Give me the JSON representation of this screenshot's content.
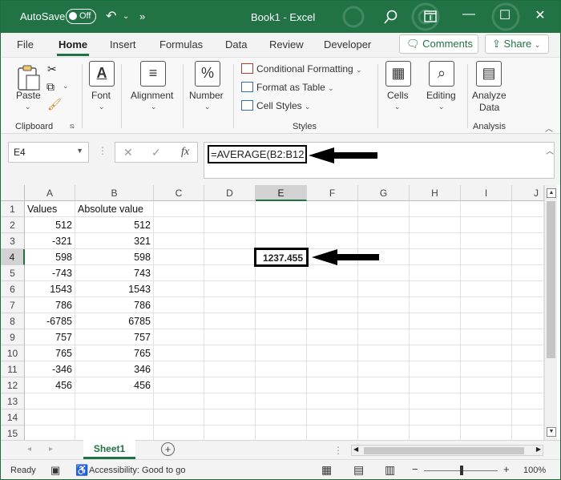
{
  "titlebar": {
    "autosave_label": "AutoSave",
    "toggle_state": "Off",
    "document_title": "Book1 - Excel",
    "undo_icon": "undo-icon",
    "more_icon": "chevron-double-right-icon",
    "search_icon": "search-icon",
    "brand_color": "#217346"
  },
  "menu": {
    "tabs": [
      "File",
      "Home",
      "Insert",
      "Formulas",
      "Data",
      "Review",
      "Developer"
    ],
    "active_tab": "Home",
    "comments_label": "Comments",
    "share_label": "Share"
  },
  "ribbon": {
    "paste_label": "Paste",
    "font_label": "Font",
    "alignment_label": "Alignment",
    "number_label": "Number",
    "conditional_formatting_label": "Conditional Formatting",
    "format_as_table_label": "Format as Table",
    "cell_styles_label": "Cell Styles",
    "cells_label": "Cells",
    "editing_label": "Editing",
    "analyze_data_label_1": "Analyze",
    "analyze_data_label_2": "Data",
    "clipboard_group": "Clipboard",
    "styles_group": "Styles",
    "analysis_group": "Analysis"
  },
  "formula_bar": {
    "name_box": "E4",
    "fx_label": "fx",
    "formula": "=AVERAGE(B2:B12"
  },
  "grid": {
    "columns": [
      "A",
      "B",
      "C",
      "D",
      "E",
      "F",
      "G",
      "H",
      "I",
      "J"
    ],
    "selected_column": "E",
    "rows": [
      "1",
      "2",
      "3",
      "4",
      "5",
      "6",
      "7",
      "8",
      "9",
      "10",
      "11",
      "12",
      "13",
      "14",
      "15"
    ],
    "selected_row": "4",
    "header_a": "Values",
    "header_b": "Absolute value",
    "values": [
      "512",
      "-321",
      "598",
      "-743",
      "1543",
      "786",
      "-6785",
      "757",
      "765",
      "-346",
      "456"
    ],
    "absolute_values": [
      "512",
      "321",
      "598",
      "743",
      "1543",
      "786",
      "6785",
      "757",
      "765",
      "346",
      "456"
    ],
    "result": "1237.455"
  },
  "sheets": {
    "active": "Sheet1"
  },
  "status": {
    "ready": "Ready",
    "accessibility": "Accessibility: Good to go",
    "zoom": "100%"
  }
}
